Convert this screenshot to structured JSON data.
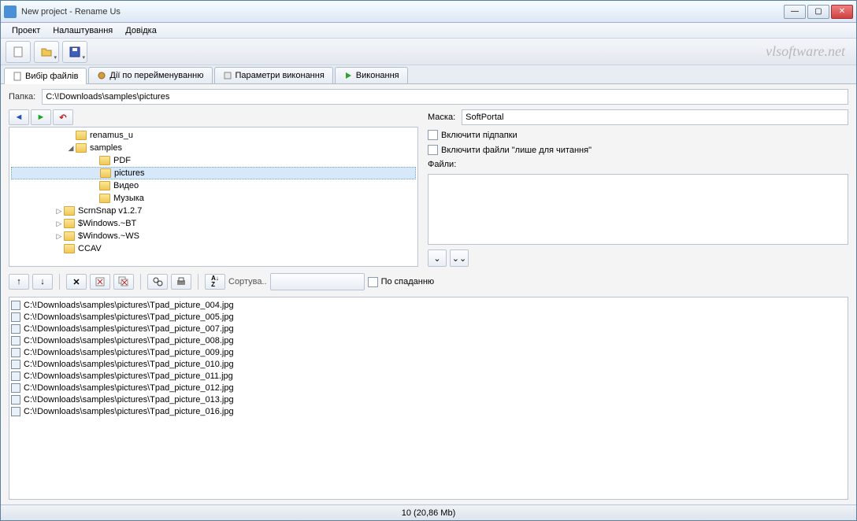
{
  "window": {
    "title": "New project - Rename Us"
  },
  "menu": {
    "project": "Проект",
    "settings": "Налаштування",
    "help": "Довідка"
  },
  "brand": "vlsoftware.net",
  "tabs": {
    "t0": "Вибір файлів",
    "t1": "Дії по перейменуванню",
    "t2": "Параметри виконання",
    "t3": "Виконання"
  },
  "labels": {
    "folder": "Папка:",
    "mask": "Маска:",
    "include_sub": "Включити підпапки",
    "include_ro": "Включити файли \"лише для читання\"",
    "files": "Файли:",
    "sort": "Сортува..",
    "desc": "По спаданню"
  },
  "path": "C:\\!Downloads\\samples\\pictures",
  "mask": "SoftPortal",
  "tree": {
    "n0": "renamus_u",
    "n1": "samples",
    "n2": "PDF",
    "n3": "pictures",
    "n4": "Видео",
    "n5": "Музыка",
    "n6": "ScrnSnap v1.2.7",
    "n7": "$Windows.~BT",
    "n8": "$Windows.~WS",
    "n9": "CCAV"
  },
  "files": [
    "C:\\!Downloads\\samples\\pictures\\Tpad_picture_004.jpg",
    "C:\\!Downloads\\samples\\pictures\\Tpad_picture_005.jpg",
    "C:\\!Downloads\\samples\\pictures\\Tpad_picture_007.jpg",
    "C:\\!Downloads\\samples\\pictures\\Tpad_picture_008.jpg",
    "C:\\!Downloads\\samples\\pictures\\Tpad_picture_009.jpg",
    "C:\\!Downloads\\samples\\pictures\\Tpad_picture_010.jpg",
    "C:\\!Downloads\\samples\\pictures\\Tpad_picture_011.jpg",
    "C:\\!Downloads\\samples\\pictures\\Tpad_picture_012.jpg",
    "C:\\!Downloads\\samples\\pictures\\Tpad_picture_013.jpg",
    "C:\\!Downloads\\samples\\pictures\\Tpad_picture_016.jpg"
  ],
  "status": "10  (20,86 Mb)"
}
